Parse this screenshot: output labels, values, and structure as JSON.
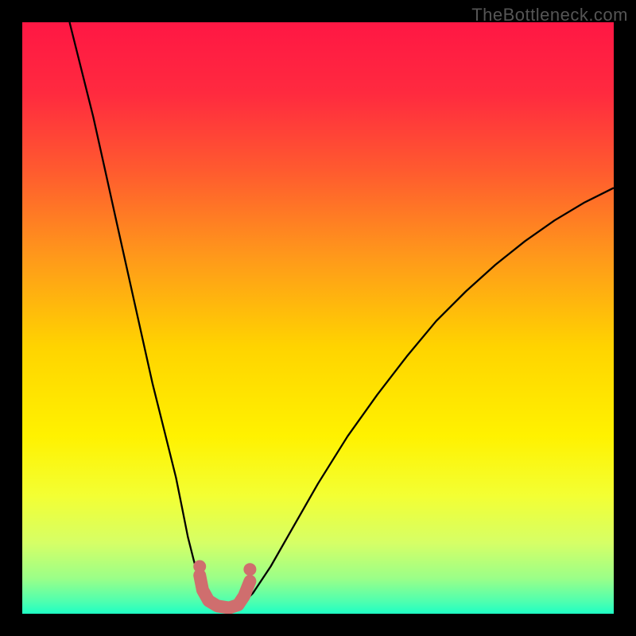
{
  "watermark": "TheBottleneck.com",
  "chart_data": {
    "type": "line",
    "title": "",
    "xlabel": "",
    "ylabel": "",
    "xlim": [
      0,
      100
    ],
    "ylim": [
      0,
      100
    ],
    "background_gradient": {
      "stops": [
        {
          "offset": 0.0,
          "color": "#ff1744"
        },
        {
          "offset": 0.12,
          "color": "#ff2a3f"
        },
        {
          "offset": 0.25,
          "color": "#ff5a2f"
        },
        {
          "offset": 0.4,
          "color": "#ff9a1a"
        },
        {
          "offset": 0.55,
          "color": "#ffd400"
        },
        {
          "offset": 0.7,
          "color": "#fff200"
        },
        {
          "offset": 0.8,
          "color": "#f3ff33"
        },
        {
          "offset": 0.88,
          "color": "#d6ff66"
        },
        {
          "offset": 0.94,
          "color": "#9bff88"
        },
        {
          "offset": 0.98,
          "color": "#4dffb0"
        },
        {
          "offset": 1.0,
          "color": "#1fffc4"
        }
      ]
    },
    "series": [
      {
        "name": "left-branch",
        "stroke": "#000000",
        "stroke_width": 2.3,
        "points": [
          {
            "x": 8.0,
            "y": 100.0
          },
          {
            "x": 10.0,
            "y": 92.0
          },
          {
            "x": 12.0,
            "y": 84.0
          },
          {
            "x": 14.0,
            "y": 75.0
          },
          {
            "x": 16.0,
            "y": 66.0
          },
          {
            "x": 18.0,
            "y": 57.0
          },
          {
            "x": 20.0,
            "y": 48.0
          },
          {
            "x": 22.0,
            "y": 39.0
          },
          {
            "x": 24.0,
            "y": 31.0
          },
          {
            "x": 26.0,
            "y": 23.0
          },
          {
            "x": 27.0,
            "y": 18.0
          },
          {
            "x": 28.0,
            "y": 13.0
          },
          {
            "x": 29.0,
            "y": 9.0
          },
          {
            "x": 30.0,
            "y": 5.5
          },
          {
            "x": 31.0,
            "y": 3.0
          },
          {
            "x": 32.0,
            "y": 1.5
          }
        ]
      },
      {
        "name": "right-branch",
        "stroke": "#000000",
        "stroke_width": 2.3,
        "points": [
          {
            "x": 37.0,
            "y": 1.5
          },
          {
            "x": 39.0,
            "y": 3.5
          },
          {
            "x": 42.0,
            "y": 8.0
          },
          {
            "x": 46.0,
            "y": 15.0
          },
          {
            "x": 50.0,
            "y": 22.0
          },
          {
            "x": 55.0,
            "y": 30.0
          },
          {
            "x": 60.0,
            "y": 37.0
          },
          {
            "x": 65.0,
            "y": 43.5
          },
          {
            "x": 70.0,
            "y": 49.5
          },
          {
            "x": 75.0,
            "y": 54.5
          },
          {
            "x": 80.0,
            "y": 59.0
          },
          {
            "x": 85.0,
            "y": 63.0
          },
          {
            "x": 90.0,
            "y": 66.5
          },
          {
            "x": 95.0,
            "y": 69.5
          },
          {
            "x": 100.0,
            "y": 72.0
          }
        ]
      },
      {
        "name": "highlight-bottom",
        "stroke": "#cf6e6e",
        "stroke_width": 16,
        "linecap": "round",
        "points": [
          {
            "x": 30.0,
            "y": 6.5
          },
          {
            "x": 30.5,
            "y": 4.0
          },
          {
            "x": 31.5,
            "y": 2.2
          },
          {
            "x": 33.0,
            "y": 1.3
          },
          {
            "x": 35.0,
            "y": 1.0
          },
          {
            "x": 36.5,
            "y": 1.5
          },
          {
            "x": 37.5,
            "y": 3.0
          },
          {
            "x": 38.5,
            "y": 5.5
          }
        ]
      }
    ],
    "markers": [
      {
        "name": "dot-left",
        "x": 30.0,
        "y": 8.0,
        "r": 8,
        "fill": "#cf6e6e"
      },
      {
        "name": "dot-right",
        "x": 38.5,
        "y": 7.5,
        "r": 8,
        "fill": "#cf6e6e"
      }
    ]
  }
}
